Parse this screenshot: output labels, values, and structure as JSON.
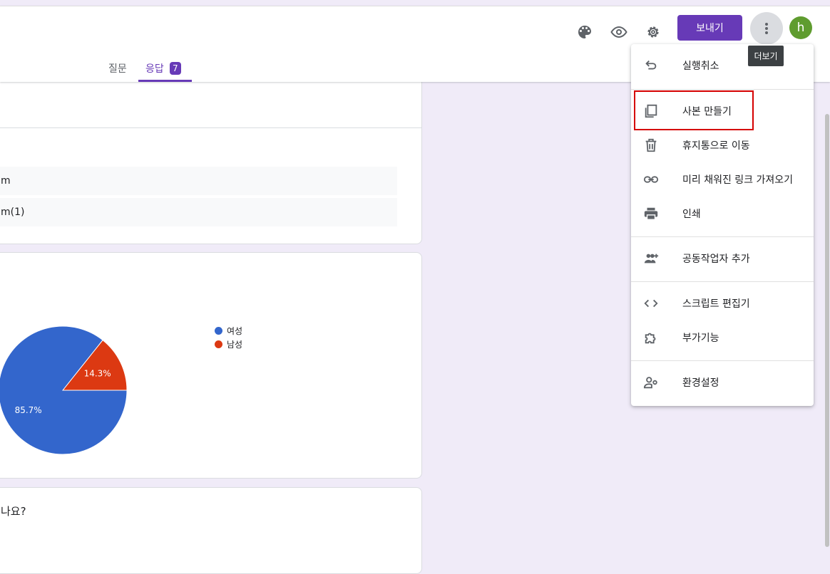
{
  "header": {
    "send_label": "보내기",
    "avatar_initial": "h",
    "tooltip": "더보기",
    "tabs": [
      {
        "label": "질문"
      },
      {
        "label": "응답",
        "count": "7"
      }
    ]
  },
  "summary": {
    "row1": "m",
    "row2": "m(1)"
  },
  "chart_data": {
    "type": "pie",
    "categories": [
      "여성",
      "남성"
    ],
    "values": [
      85.7,
      14.3
    ],
    "labels": [
      "85.7%",
      "14.3%"
    ],
    "colors": [
      "#3366cc",
      "#dc3912"
    ],
    "legend_position": "right"
  },
  "next_question_fragment": "나요?",
  "menu": {
    "items": [
      {
        "label": "실행취소",
        "icon": "undo-icon"
      },
      {
        "label": "사본 만들기",
        "icon": "copy-icon"
      },
      {
        "label": "휴지통으로 이동",
        "icon": "trash-icon"
      },
      {
        "label": "미리 채워진 링크 가져오기",
        "icon": "link-icon"
      },
      {
        "label": "인쇄",
        "icon": "print-icon"
      },
      {
        "label": "공동작업자 추가",
        "icon": "add-people-icon"
      },
      {
        "label": "스크립트 편집기",
        "icon": "code-icon"
      },
      {
        "label": "부가기능",
        "icon": "puzzle-icon"
      },
      {
        "label": "환경설정",
        "icon": "person-settings-icon"
      }
    ]
  },
  "colors": {
    "accent": "#673ab7",
    "background": "#f0ebf8",
    "highlight": "#d50000"
  }
}
